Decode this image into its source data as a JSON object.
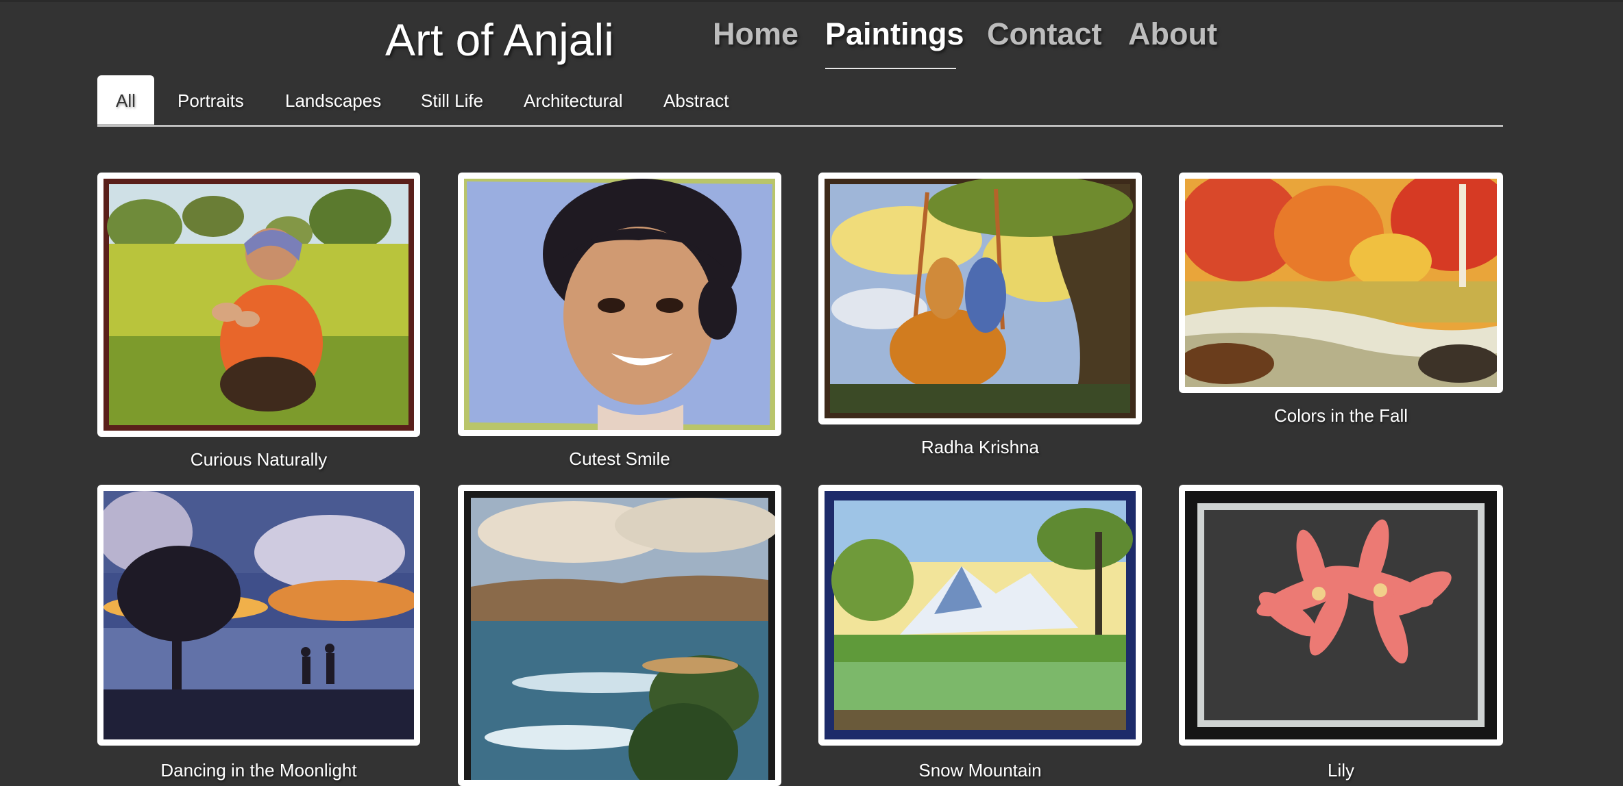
{
  "site": {
    "title": "Art of Anjali"
  },
  "nav": {
    "home": "Home",
    "paintings": "Paintings",
    "contact": "Contact",
    "about": "About"
  },
  "filters": {
    "all": "All",
    "portraits": "Portraits",
    "landscapes": "Landscapes",
    "still_life": "Still Life",
    "architectural": "Architectural",
    "abstract": "Abstract"
  },
  "paintings": [
    {
      "title": "Curious Naturally"
    },
    {
      "title": "Cutest Smile"
    },
    {
      "title": "Radha Krishna"
    },
    {
      "title": "Colors in the Fall"
    },
    {
      "title": "Dancing in the Moonlight"
    },
    {
      "title": ""
    },
    {
      "title": "Snow Mountain"
    },
    {
      "title": "Lily"
    }
  ],
  "colors": {
    "background": "#333333",
    "frame": "#ffffff",
    "nav_inactive": "#bdbdbd",
    "nav_active": "#ffffff"
  }
}
